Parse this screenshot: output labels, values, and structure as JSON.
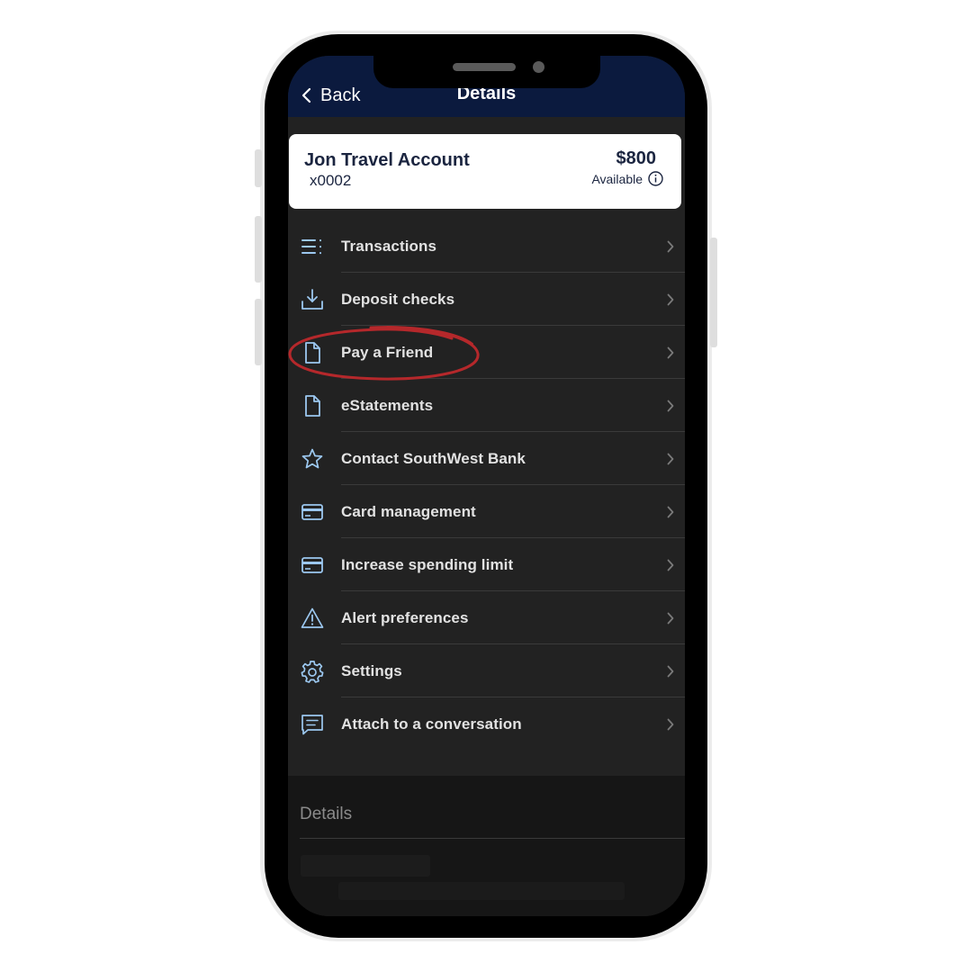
{
  "nav": {
    "back_label": "Back",
    "title": "Details"
  },
  "account": {
    "name": "Jon Travel Account",
    "number": "x0002",
    "amount": "$800",
    "available_label": "Available"
  },
  "menu": {
    "items": [
      {
        "label": "Transactions",
        "icon": "list-icon"
      },
      {
        "label": "Deposit checks",
        "icon": "download-tray-icon"
      },
      {
        "label": "Pay a Friend",
        "icon": "document-icon"
      },
      {
        "label": "eStatements",
        "icon": "document-icon"
      },
      {
        "label": "Contact SouthWest Bank",
        "icon": "star-icon"
      },
      {
        "label": "Card management",
        "icon": "credit-card-icon"
      },
      {
        "label": "Increase spending limit",
        "icon": "credit-card-icon"
      },
      {
        "label": "Alert preferences",
        "icon": "warning-triangle-icon"
      },
      {
        "label": "Settings",
        "icon": "gear-icon"
      },
      {
        "label": "Attach to a conversation",
        "icon": "chat-bubble-icon"
      }
    ]
  },
  "details": {
    "label": "Details"
  },
  "colors": {
    "navbar": "#0b1a3e",
    "icon_blue": "#9cc8f0",
    "highlight_ring": "#b5282b",
    "screen_bg": "#222222"
  }
}
